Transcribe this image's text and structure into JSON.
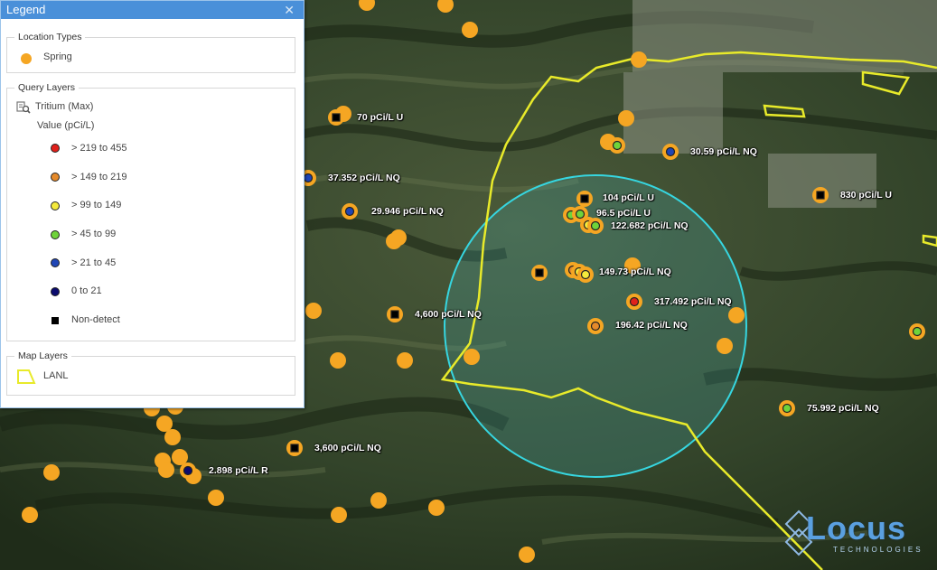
{
  "legend": {
    "title": "Legend",
    "close_icon": "close-icon",
    "location_types": {
      "caption": "Location Types",
      "items": [
        {
          "label": "Spring",
          "color": "#f5a623"
        }
      ]
    },
    "query_layers": {
      "caption": "Query Layers",
      "layer_name": "Tritium (Max)",
      "layer_icon": "query-layer-icon",
      "value_title": "Value (pCi/L)",
      "ranges": [
        {
          "label": "> 219 to 455",
          "color": "#e0201b"
        },
        {
          "label": "> 149 to 219",
          "color": "#e58a2b"
        },
        {
          "label": "> 99 to 149",
          "color": "#f4ea3c"
        },
        {
          "label": "> 45 to 99",
          "color": "#6fd33a"
        },
        {
          "label": "> 21 to 45",
          "color": "#1f45b5"
        },
        {
          "label": "0 to 21",
          "color": "#0b0b6e"
        }
      ],
      "non_detect": "Non-detect"
    },
    "map_layers": {
      "caption": "Map Layers",
      "items": [
        {
          "label": "LANL",
          "color": "#e8ea2a"
        }
      ]
    }
  },
  "map": {
    "buffer_color": "#36d6e0",
    "boundary_color": "#e8ea2a",
    "spring_color": "#f5a623",
    "labels": [
      "70 pCi/L U",
      "37.352 pCi/L NQ",
      "29.946 pCi/L NQ",
      "4,600 pCi/L NQ",
      "3,600 pCi/L NQ",
      "2.898 pCi/L R",
      "30.59 pCi/L NQ",
      "830 pCi/L U",
      "104 pCi/L U",
      "96.5 pCi/L U",
      "122.682 pCi/L NQ",
      "149.73 pCi/L NQ",
      "317.492 pCi/L NQ",
      "196.42 pCi/L NQ",
      "75.992 pCi/L NQ"
    ]
  },
  "logo": {
    "name": "Locus",
    "subtitle": "TECHNOLOGIES"
  }
}
